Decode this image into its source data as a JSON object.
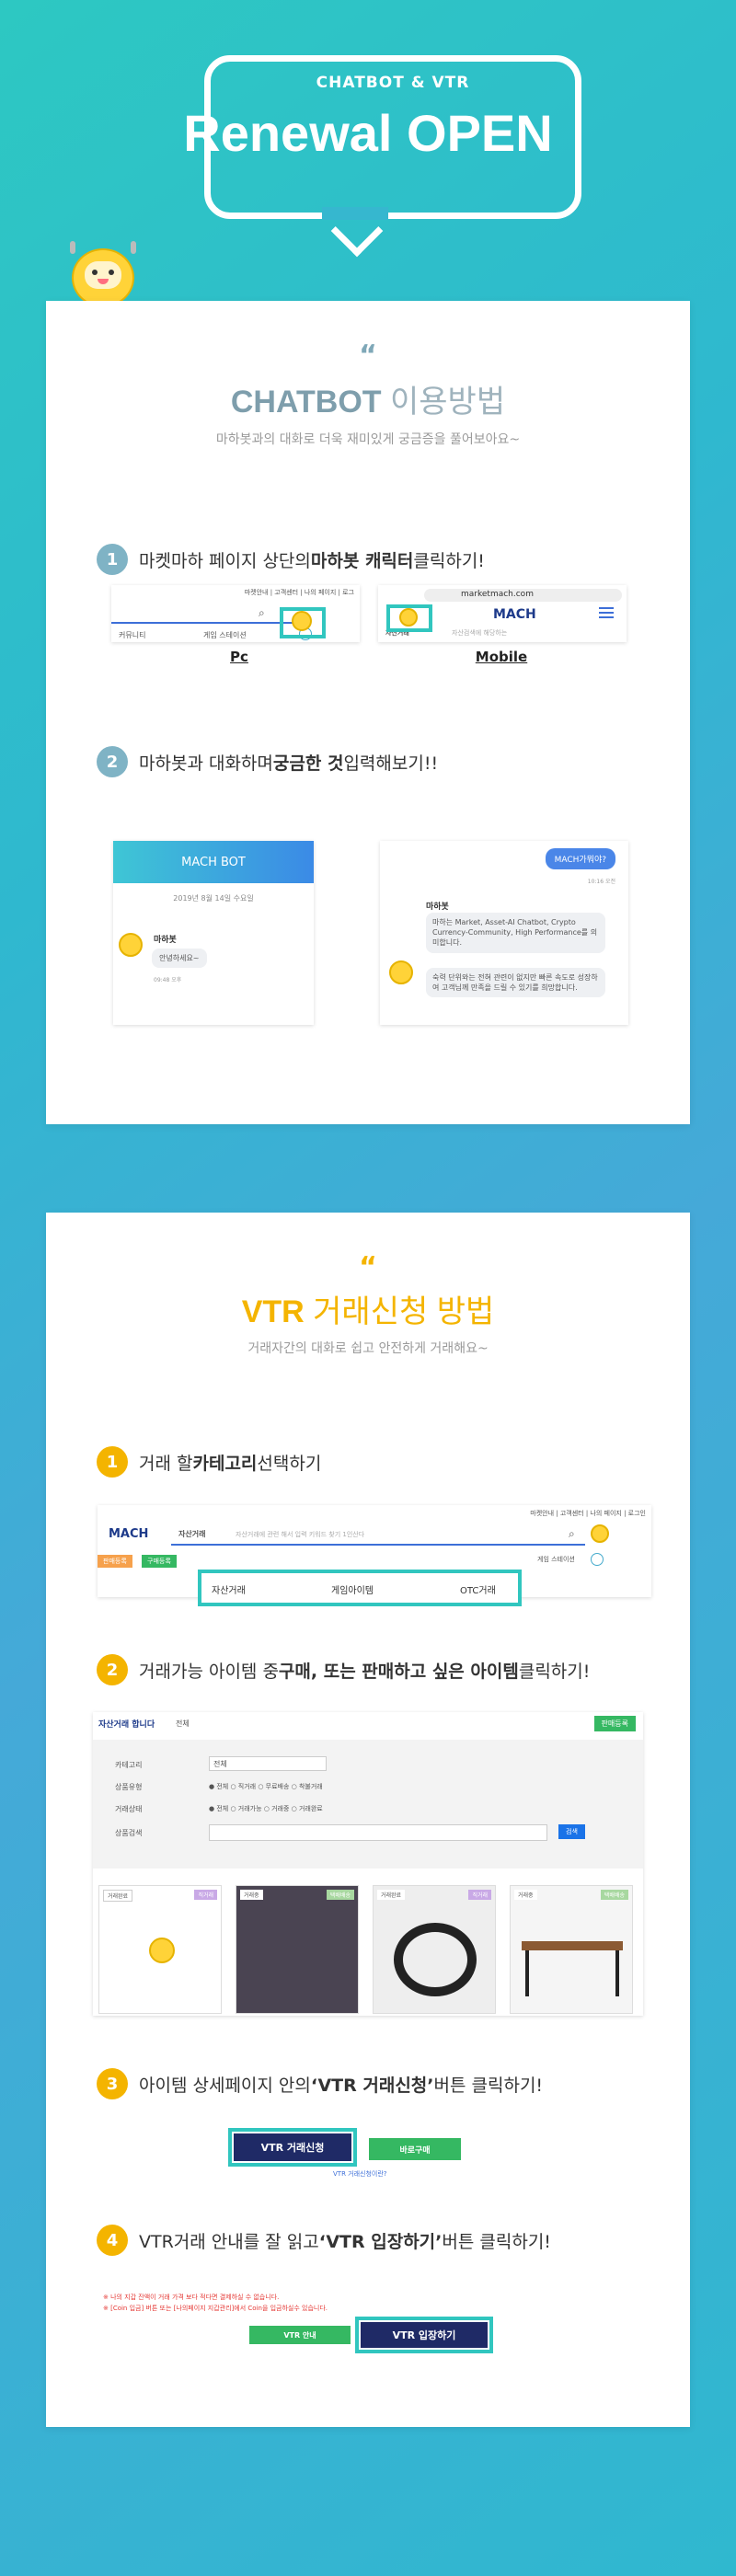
{
  "header": {
    "small": "CHATBOT & VTR",
    "big": "Renewal OPEN"
  },
  "chatbot": {
    "quote": "“",
    "title_en": "CHATBOT",
    "title_ko": " 이용방법",
    "subtitle": "마하봇과의 대화로 더욱 재미있게 궁금증을 풀어보아요~",
    "step1": {
      "num": "1",
      "pre": "마켓마하 페이지 상단의 ",
      "bold": "마하봇 캐릭터",
      "post": " 클릭하기!"
    },
    "pc_label": "Pc",
    "mobile_label": "Mobile",
    "pc_nav": "마켓안내 | 고객센터 | 나의 페이지 | 로그",
    "pc_menu1": "커뮤니티",
    "pc_menu2": "게임 스테이션",
    "mobile_url": "marketmach.com",
    "mobile_brand": "MACH",
    "mobile_cat": "자산거래",
    "mobile_search": "자산검색에 해당하는",
    "step2": {
      "num": "2",
      "pre": "마하봇과 대화하며 ",
      "bold": "궁금한 것",
      "post": " 입력해보기!!"
    },
    "bot_title": "MACH BOT",
    "bot_date": "2019년 8월 14일 수요일",
    "bot_name": "마하봇",
    "bot_greet": "안녕하세요~",
    "bot_time": "09:48 오후",
    "user_msg": "MACH가뭐야?",
    "user_time": "10:16 오전",
    "bot_name2": "마하봇",
    "bot_reply1": "마하는 Market, Asset-AI Chatbot, Crypto Currency-Community, High Performance를 의미합니다.",
    "bot_reply2": "숙력 단위와는 전혀 관련이 없지만 빠른 속도로 성장하여 고객님께 만족을 드릴 수 있기를 희망합니다."
  },
  "vtr": {
    "quote": "“",
    "title_en": "VTR",
    "title_ko": " 거래신청 방법",
    "subtitle": "거래자간의 대화로 쉽고 안전하게 거래해요~",
    "step1": {
      "num": "1",
      "pre": "거래 할 ",
      "bold": "카테고리",
      "post": " 선택하기"
    },
    "cat_brand": "MACH",
    "cat_tab": "자산거래",
    "cat_search": "자산거래에 관련 해서 입력 키워드 찾기 1인산다",
    "cat_btn1": "판매등록",
    "cat_btn2": "구매등록",
    "cat_station": "게임 스테이션",
    "cat_items": [
      "자산거래",
      "게임아이템",
      "OTC거래"
    ],
    "top_nav": "마켓안내 | 고객센터 | 나의 페이지 | 로그인",
    "step2": {
      "num": "2",
      "pre": "거래가능 아이템 중 ",
      "bold": "구매, 또는 판매하고 싶은 아이템",
      "post": " 클릭하기!"
    },
    "list_title": "자산거래 합니다",
    "list_sub": "전체",
    "list_btn": "판매등록",
    "filters": [
      {
        "label": "카테고리",
        "value": "전체"
      },
      {
        "label": "상품유형",
        "value": "● 전체   ○ 직거래   ○ 무료배송   ○ 착불거래"
      },
      {
        "label": "거래상태",
        "value": "● 전체   ○ 거래가능   ○ 거래중   ○ 거래완료"
      },
      {
        "label": "상품검색",
        "value": ""
      }
    ],
    "search_btn": "검색",
    "cards": [
      {
        "tag": "거래완료",
        "tag2": "직거래"
      },
      {
        "tag": "거래중",
        "tag2": "택배배송"
      },
      {
        "tag": "거래완료",
        "tag2": "직거래"
      },
      {
        "tag": "거래중",
        "tag2": "택배배송"
      }
    ],
    "step3": {
      "num": "3",
      "pre": "아이템 상세페이지 안의 ",
      "bold": "‘VTR 거래신청’",
      "post": " 버튼 클릭하기!"
    },
    "vtr_apply": "VTR 거래신청",
    "buy_btn": "바로구매",
    "vtr_help": "VTR 거래신청이란?",
    "step4": {
      "num": "4",
      "pre": "VTR거래 안내를 잘 읽고 ",
      "bold": "‘VTR 입장하기’",
      "post": " 버튼 클릭하기!"
    },
    "warn1": "※ 나의 지갑 잔액이 거래 가격 보다 적다면 결제하실 수 없습니다.",
    "warn2": "※ [Coin 입금] 버튼 또는 [나의페이지 지갑관리]에서 Coin을 입금하실수 있습니다.",
    "vtr_guide": "VTR 안내",
    "vtr_enter": "VTR 입장하기"
  }
}
